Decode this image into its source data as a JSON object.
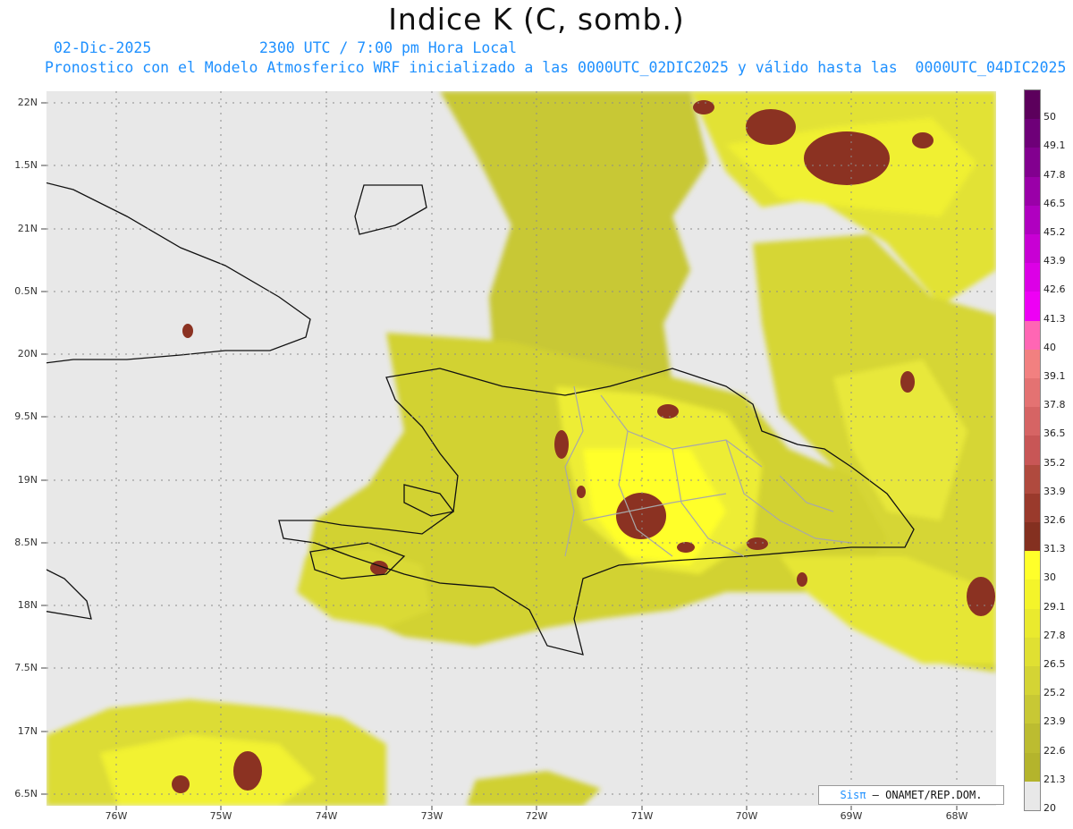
{
  "title": "Indice K (C, somb.)",
  "date_label": "02-Dic-2025",
  "time_label": "2300 UTC / 7:00 pm Hora Local",
  "init_label": "Pronostico con el Modelo Atmosferico WRF inicializado a las 0000UTC_02DIC2025 y válido hasta las  0000UTC_04DIC2025",
  "credit": {
    "brand": "Sisπ",
    "text": " – ONAMET/REP.DOM."
  },
  "axes": {
    "y_ticks": [
      "22N",
      "1.5N",
      "21N",
      "0.5N",
      "20N",
      "9.5N",
      "19N",
      "8.5N",
      "18N",
      "7.5N",
      "17N",
      "6.5N"
    ],
    "x_ticks": [
      "76W",
      "75W",
      "74W",
      "73W",
      "72W",
      "71W",
      "70W",
      "69W",
      "68W"
    ]
  },
  "colorbar": {
    "labels": [
      "50",
      "49.1",
      "47.8",
      "46.5",
      "45.2",
      "43.9",
      "42.6",
      "41.3",
      "40",
      "39.1",
      "37.8",
      "36.5",
      "35.2",
      "33.9",
      "32.6",
      "31.3",
      "30",
      "29.1",
      "27.8",
      "26.5",
      "25.2",
      "23.9",
      "22.6",
      "21.3",
      "20"
    ],
    "colors": [
      "#5c005c",
      "#6e0078",
      "#82008f",
      "#9a00a8",
      "#b000c0",
      "#c800d4",
      "#dc00e6",
      "#ee00f5",
      "#ff66b4",
      "#f28080",
      "#e47272",
      "#d66464",
      "#c85656",
      "#b04a3e",
      "#9a3a2c",
      "#843020",
      "#ffff2a",
      "#f4f42a",
      "#eaea2e",
      "#e0e032",
      "#d4d434",
      "#c8c834",
      "#bcbc30",
      "#b4b42c",
      "#e8e8e8"
    ]
  },
  "legend_colors": {
    "background": "#e8e8e8",
    "field_low": "#c4c42e",
    "field_mid": "#e6e638",
    "field_high": "#ffff2a",
    "field_max": "#8b3222",
    "coast": "#111111",
    "provinces": "#a0a0a0"
  }
}
